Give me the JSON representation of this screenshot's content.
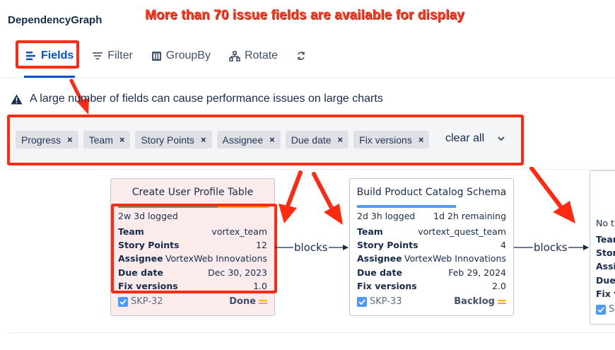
{
  "app": {
    "title": "DependencyGraph"
  },
  "annotation": {
    "banner": "More than 70 issue fields are available for display"
  },
  "toolbar": {
    "items": [
      {
        "label": "Fields",
        "icon": "fields-icon",
        "active": true
      },
      {
        "label": "Filter",
        "icon": "filter-icon",
        "active": false
      },
      {
        "label": "GroupBy",
        "icon": "groupby-icon",
        "active": false
      },
      {
        "label": "Rotate",
        "icon": "rotate-icon",
        "active": false
      },
      {
        "label": "",
        "icon": "refresh-icon",
        "active": false
      }
    ]
  },
  "warning": {
    "icon": "warning-icon",
    "text": "A large number of fields can cause performance issues on large charts"
  },
  "field_chips": [
    {
      "label": "Progress"
    },
    {
      "label": "Team"
    },
    {
      "label": "Story Points"
    },
    {
      "label": "Assignee"
    },
    {
      "label": "Due date"
    },
    {
      "label": "Fix versions"
    }
  ],
  "chip_remove_glyph": "×",
  "clear_all_label": "clear all",
  "graph": {
    "edge_label": "blocks",
    "cards": [
      {
        "title": "Create User Profile Table",
        "logged": "2w 3d logged",
        "remaining": "",
        "progress_fraction": 0.64,
        "fields": [
          {
            "k": "Team",
            "v": "vortex_team"
          },
          {
            "k": "Story Points",
            "v": "12"
          },
          {
            "k": "Assignee",
            "v": "VortexWeb Innovations"
          },
          {
            "k": "Due date",
            "v": "Dec 30, 2023"
          },
          {
            "k": "Fix versions",
            "v": "1.0"
          }
        ],
        "key": "SKP-32",
        "status": "Done"
      },
      {
        "title": "Build Product Catalog Schema",
        "logged": "2d 3h logged",
        "remaining": "1d 2h remaining",
        "progress_fraction": 0.62,
        "fields": [
          {
            "k": "Team",
            "v": "vortext_quest_team"
          },
          {
            "k": "Story Points",
            "v": "4"
          },
          {
            "k": "Assignee",
            "v": "VortexWeb Innovations"
          },
          {
            "k": "Due date",
            "v": "Feb 29, 2024"
          },
          {
            "k": "Fix versions",
            "v": "2.0"
          }
        ],
        "key": "SKP-33",
        "status": "Backlog"
      },
      {
        "title": "",
        "logged": "No ti",
        "fields": [
          {
            "k": "Team"
          },
          {
            "k": "Story"
          },
          {
            "k": "Assig"
          },
          {
            "k": "Due"
          },
          {
            "k": "Fix v"
          }
        ],
        "key": "SK"
      }
    ]
  },
  "colors": {
    "accent": "#0052cc",
    "highlight": "#ff2a12",
    "progress_green": "#36b37e",
    "progress_orange": "#ffab00",
    "progress_blue": "#4c9aff"
  }
}
